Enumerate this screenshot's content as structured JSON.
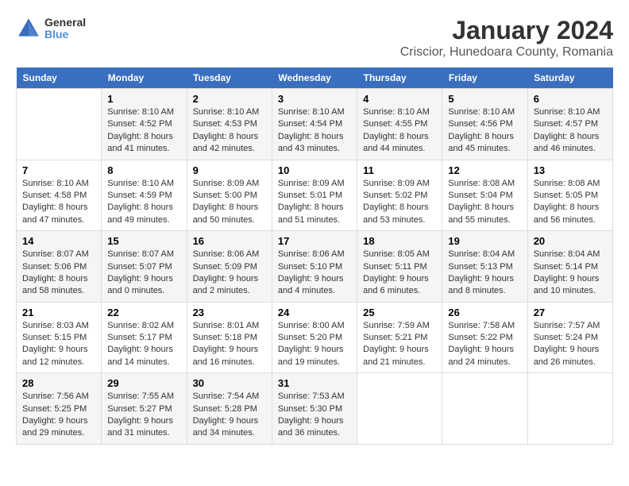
{
  "logo": {
    "line1": "General",
    "line2": "Blue"
  },
  "title": "January 2024",
  "subtitle": "Criscior, Hunedoara County, Romania",
  "headers": [
    "Sunday",
    "Monday",
    "Tuesday",
    "Wednesday",
    "Thursday",
    "Friday",
    "Saturday"
  ],
  "weeks": [
    [
      {
        "day": "",
        "info": ""
      },
      {
        "day": "1",
        "info": "Sunrise: 8:10 AM\nSunset: 4:52 PM\nDaylight: 8 hours\nand 41 minutes."
      },
      {
        "day": "2",
        "info": "Sunrise: 8:10 AM\nSunset: 4:53 PM\nDaylight: 8 hours\nand 42 minutes."
      },
      {
        "day": "3",
        "info": "Sunrise: 8:10 AM\nSunset: 4:54 PM\nDaylight: 8 hours\nand 43 minutes."
      },
      {
        "day": "4",
        "info": "Sunrise: 8:10 AM\nSunset: 4:55 PM\nDaylight: 8 hours\nand 44 minutes."
      },
      {
        "day": "5",
        "info": "Sunrise: 8:10 AM\nSunset: 4:56 PM\nDaylight: 8 hours\nand 45 minutes."
      },
      {
        "day": "6",
        "info": "Sunrise: 8:10 AM\nSunset: 4:57 PM\nDaylight: 8 hours\nand 46 minutes."
      }
    ],
    [
      {
        "day": "7",
        "info": "Sunrise: 8:10 AM\nSunset: 4:58 PM\nDaylight: 8 hours\nand 47 minutes."
      },
      {
        "day": "8",
        "info": "Sunrise: 8:10 AM\nSunset: 4:59 PM\nDaylight: 8 hours\nand 49 minutes."
      },
      {
        "day": "9",
        "info": "Sunrise: 8:09 AM\nSunset: 5:00 PM\nDaylight: 8 hours\nand 50 minutes."
      },
      {
        "day": "10",
        "info": "Sunrise: 8:09 AM\nSunset: 5:01 PM\nDaylight: 8 hours\nand 51 minutes."
      },
      {
        "day": "11",
        "info": "Sunrise: 8:09 AM\nSunset: 5:02 PM\nDaylight: 8 hours\nand 53 minutes."
      },
      {
        "day": "12",
        "info": "Sunrise: 8:08 AM\nSunset: 5:04 PM\nDaylight: 8 hours\nand 55 minutes."
      },
      {
        "day": "13",
        "info": "Sunrise: 8:08 AM\nSunset: 5:05 PM\nDaylight: 8 hours\nand 56 minutes."
      }
    ],
    [
      {
        "day": "14",
        "info": "Sunrise: 8:07 AM\nSunset: 5:06 PM\nDaylight: 8 hours\nand 58 minutes."
      },
      {
        "day": "15",
        "info": "Sunrise: 8:07 AM\nSunset: 5:07 PM\nDaylight: 9 hours\nand 0 minutes."
      },
      {
        "day": "16",
        "info": "Sunrise: 8:06 AM\nSunset: 5:09 PM\nDaylight: 9 hours\nand 2 minutes."
      },
      {
        "day": "17",
        "info": "Sunrise: 8:06 AM\nSunset: 5:10 PM\nDaylight: 9 hours\nand 4 minutes."
      },
      {
        "day": "18",
        "info": "Sunrise: 8:05 AM\nSunset: 5:11 PM\nDaylight: 9 hours\nand 6 minutes."
      },
      {
        "day": "19",
        "info": "Sunrise: 8:04 AM\nSunset: 5:13 PM\nDaylight: 9 hours\nand 8 minutes."
      },
      {
        "day": "20",
        "info": "Sunrise: 8:04 AM\nSunset: 5:14 PM\nDaylight: 9 hours\nand 10 minutes."
      }
    ],
    [
      {
        "day": "21",
        "info": "Sunrise: 8:03 AM\nSunset: 5:15 PM\nDaylight: 9 hours\nand 12 minutes."
      },
      {
        "day": "22",
        "info": "Sunrise: 8:02 AM\nSunset: 5:17 PM\nDaylight: 9 hours\nand 14 minutes."
      },
      {
        "day": "23",
        "info": "Sunrise: 8:01 AM\nSunset: 5:18 PM\nDaylight: 9 hours\nand 16 minutes."
      },
      {
        "day": "24",
        "info": "Sunrise: 8:00 AM\nSunset: 5:20 PM\nDaylight: 9 hours\nand 19 minutes."
      },
      {
        "day": "25",
        "info": "Sunrise: 7:59 AM\nSunset: 5:21 PM\nDaylight: 9 hours\nand 21 minutes."
      },
      {
        "day": "26",
        "info": "Sunrise: 7:58 AM\nSunset: 5:22 PM\nDaylight: 9 hours\nand 24 minutes."
      },
      {
        "day": "27",
        "info": "Sunrise: 7:57 AM\nSunset: 5:24 PM\nDaylight: 9 hours\nand 26 minutes."
      }
    ],
    [
      {
        "day": "28",
        "info": "Sunrise: 7:56 AM\nSunset: 5:25 PM\nDaylight: 9 hours\nand 29 minutes."
      },
      {
        "day": "29",
        "info": "Sunrise: 7:55 AM\nSunset: 5:27 PM\nDaylight: 9 hours\nand 31 minutes."
      },
      {
        "day": "30",
        "info": "Sunrise: 7:54 AM\nSunset: 5:28 PM\nDaylight: 9 hours\nand 34 minutes."
      },
      {
        "day": "31",
        "info": "Sunrise: 7:53 AM\nSunset: 5:30 PM\nDaylight: 9 hours\nand 36 minutes."
      },
      {
        "day": "",
        "info": ""
      },
      {
        "day": "",
        "info": ""
      },
      {
        "day": "",
        "info": ""
      }
    ]
  ]
}
